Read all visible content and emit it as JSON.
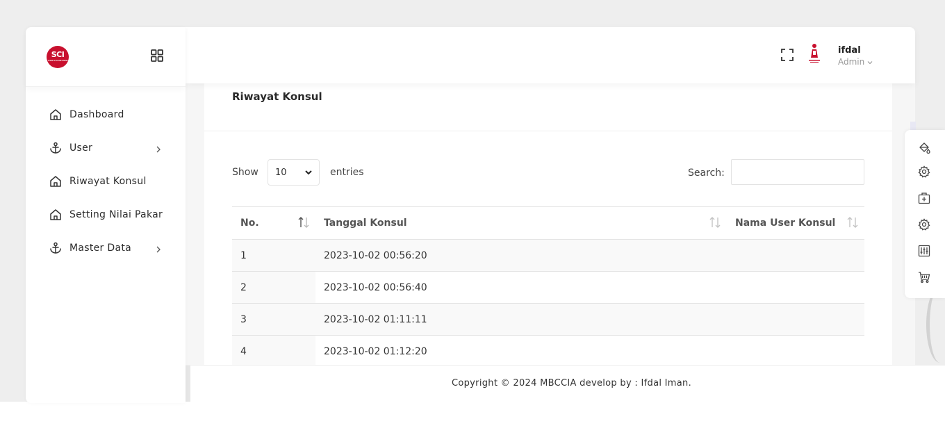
{
  "sidebar": {
    "logo_text": "SCI",
    "logo_subtext": "SMART CHECK INDONESIA",
    "items": [
      {
        "label": "Dashboard",
        "icon": "home-icon",
        "has_children": false
      },
      {
        "label": "User",
        "icon": "anchor-icon",
        "has_children": true
      },
      {
        "label": "Riwayat Konsul",
        "icon": "home-icon",
        "has_children": false
      },
      {
        "label": "Setting Nilai Pakar",
        "icon": "home-icon",
        "has_children": false
      },
      {
        "label": "Master Data",
        "icon": "anchor-icon",
        "has_children": true
      }
    ]
  },
  "header": {
    "user_name": "ifdal",
    "user_role": "Admin"
  },
  "main": {
    "card_title": "Riwayat Konsul",
    "show_label": "Show",
    "entries_value": "10",
    "entries_label": "entries",
    "search_label": "Search:",
    "search_value": "",
    "table": {
      "columns": [
        "No.",
        "Tanggal Konsul",
        "Nama User Konsul"
      ],
      "rows": [
        [
          "1",
          "2023-10-02 00:56:20",
          ""
        ],
        [
          "2",
          "2023-10-02 00:56:40",
          ""
        ],
        [
          "3",
          "2023-10-02 01:11:11",
          ""
        ],
        [
          "4",
          "2023-10-02 01:12:20",
          ""
        ]
      ]
    }
  },
  "footer": {
    "text": "Copyright © 2024 MBCCIA develop by : Ifdal Iman."
  },
  "right_panel": {
    "icons": [
      "paint-bucket-icon",
      "gear-icon",
      "first-aid-kit-icon",
      "gear-icon",
      "sliders-icon",
      "cart-icon"
    ]
  },
  "colors": {
    "brand": "#c8102e",
    "background": "#eeeeee"
  }
}
